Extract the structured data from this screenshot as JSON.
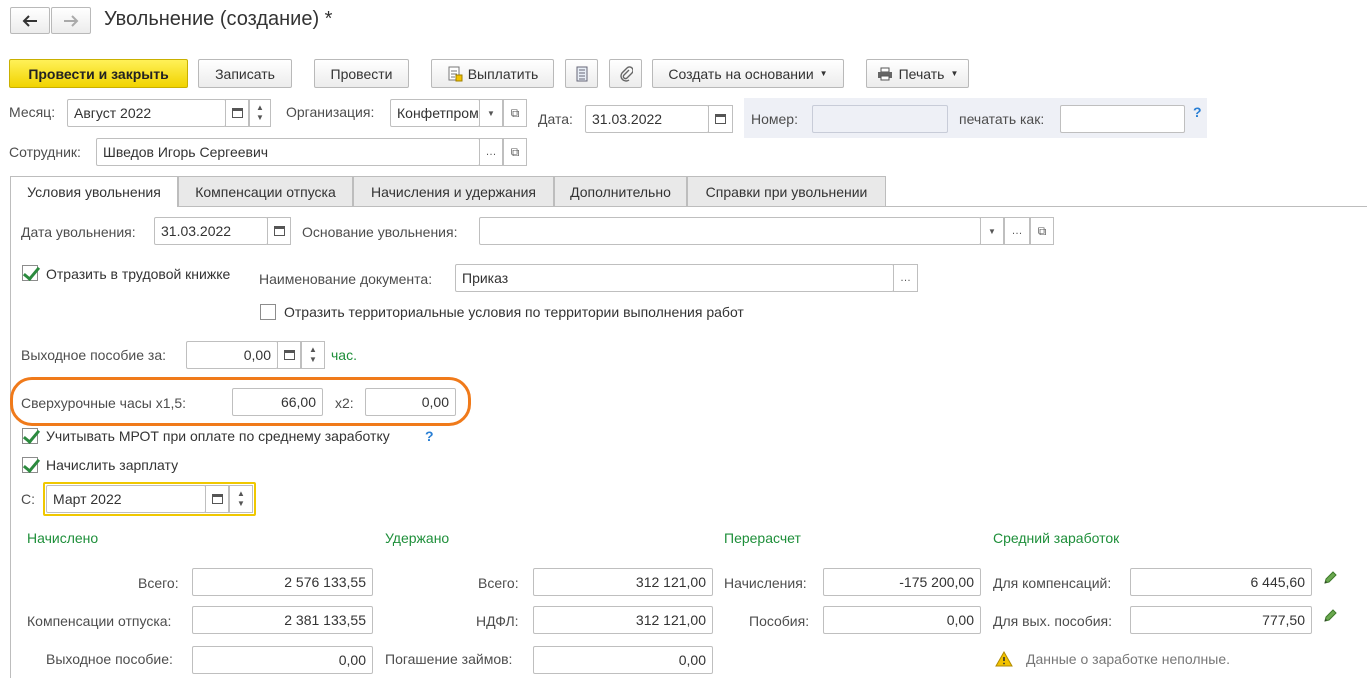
{
  "header": {
    "title": "Увольнение (создание) *",
    "back_icon": "arrow-left-icon",
    "forward_icon": "arrow-right-icon"
  },
  "toolbar": {
    "post_close": "Провести и закрыть",
    "save": "Записать",
    "post": "Провести",
    "pay": "Выплатить",
    "create_based": "Создать на основании",
    "print": "Печать"
  },
  "form": {
    "month_label": "Месяц:",
    "month_value": "Август 2022",
    "org_label": "Организация:",
    "org_value": "Конфетпром",
    "date_label": "Дата:",
    "date_value": "31.03.2022",
    "number_label": "Номер:",
    "number_value": "",
    "print_as_label": "печатать как:",
    "print_as_value": "",
    "help": "?",
    "employee_label": "Сотрудник:",
    "employee_value": "Шведов Игорь Сергеевич"
  },
  "tabs": [
    {
      "label": "Условия увольнения",
      "active": true
    },
    {
      "label": "Компенсации отпуска",
      "active": false
    },
    {
      "label": "Начисления и удержания",
      "active": false
    },
    {
      "label": "Дополнительно",
      "active": false
    },
    {
      "label": "Справки при увольнении",
      "active": false
    }
  ],
  "conditions": {
    "dismissal_date_label": "Дата увольнения:",
    "dismissal_date_value": "31.03.2022",
    "reason_label": "Основание увольнения:",
    "reason_value": "",
    "labor_book_label": "Отразить в трудовой книжке",
    "labor_book_checked": true,
    "doc_name_label": "Наименование документа:",
    "doc_name_value": "Приказ",
    "territorial_label": "Отразить территориальные условия по территории выполнения работ",
    "territorial_checked": false,
    "severance_label": "Выходное пособие за:",
    "severance_value": "0,00",
    "severance_unit": "час.",
    "overtime_label": "Сверхурочные часы x1,5:",
    "overtime_15_value": "66,00",
    "overtime_2_label": "x2:",
    "overtime_2_value": "0,00",
    "mrot_label": "Учитывать МРОТ при оплате по среднему заработку",
    "mrot_checked": true,
    "mrot_help": "?",
    "accrue_salary_label": "Начислить зарплату",
    "accrue_salary_checked": true,
    "from_label": "С:",
    "from_value": "Март 2022"
  },
  "summary": {
    "accrued": {
      "title": "Начислено",
      "total_label": "Всего:",
      "total_value": "2 576 133,55",
      "vacation_label": "Компенсации отпуска:",
      "vacation_value": "2 381 133,55",
      "severance_label": "Выходное пособие:",
      "severance_value": "0,00"
    },
    "withheld": {
      "title": "Удержано",
      "total_label": "Всего:",
      "total_value": "312 121,00",
      "ndfl_label": "НДФЛ:",
      "ndfl_value": "312 121,00",
      "loans_label": "Погашение займов:",
      "loans_value": "0,00"
    },
    "recalc": {
      "title": "Перерасчет",
      "accruals_label": "Начисления:",
      "accruals_value": "-175 200,00",
      "benefits_label": "Пособия:",
      "benefits_value": "0,00"
    },
    "avg": {
      "title": "Средний заработок",
      "comp_label": "Для компенсаций:",
      "comp_value": "6 445,60",
      "sev_label": "Для вых. пособия:",
      "sev_value": "777,50",
      "warning": "Данные о заработке неполные."
    }
  },
  "colors": {
    "primary_button": "#f5d800",
    "section_title": "#1e8f3a",
    "highlight_ring": "#f07a1a",
    "focus_border": "#f0c800"
  }
}
